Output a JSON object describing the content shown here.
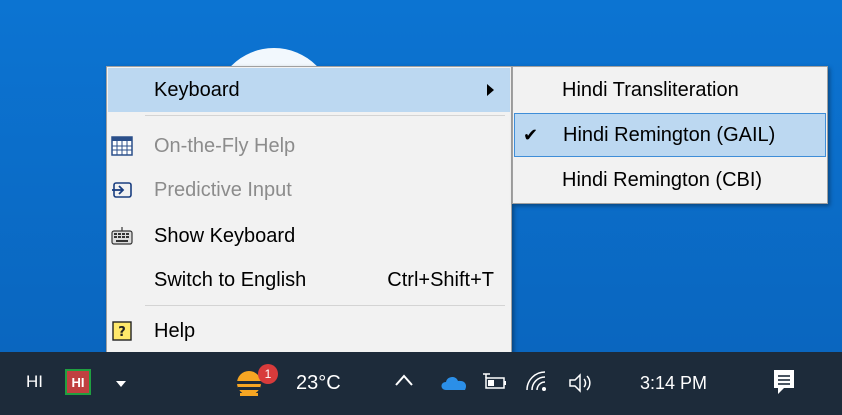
{
  "menu": {
    "keyboard_label": "Keyboard",
    "items": [
      {
        "label": "On-the-Fly Help",
        "icon": "table-icon",
        "enabled": false
      },
      {
        "label": "Predictive Input",
        "icon": "predictive-input-icon",
        "enabled": false
      },
      {
        "label": "Show Keyboard",
        "icon": "keyboard-icon",
        "enabled": true
      },
      {
        "label": "Switch to English",
        "shortcut": "Ctrl+Shift+T",
        "enabled": true
      },
      {
        "label": "Help",
        "icon": "help-icon",
        "enabled": true
      }
    ]
  },
  "submenu": {
    "items": [
      {
        "label": "Hindi Transliteration",
        "checked": false
      },
      {
        "label": "Hindi Remington (GAIL)",
        "checked": true,
        "check_mark": "✔"
      },
      {
        "label": "Hindi Remington (CBI)",
        "checked": false
      }
    ]
  },
  "taskbar": {
    "language": "HI",
    "ime_icon_text": "HI",
    "weather_badge": "1",
    "temperature": "23°C",
    "time": "3:14 PM"
  },
  "colors": {
    "desktop": "#0c6fcb",
    "menu_bg": "#f2f2f2",
    "highlight": "#bcd8f1",
    "taskbar": "#1d2b3a"
  }
}
